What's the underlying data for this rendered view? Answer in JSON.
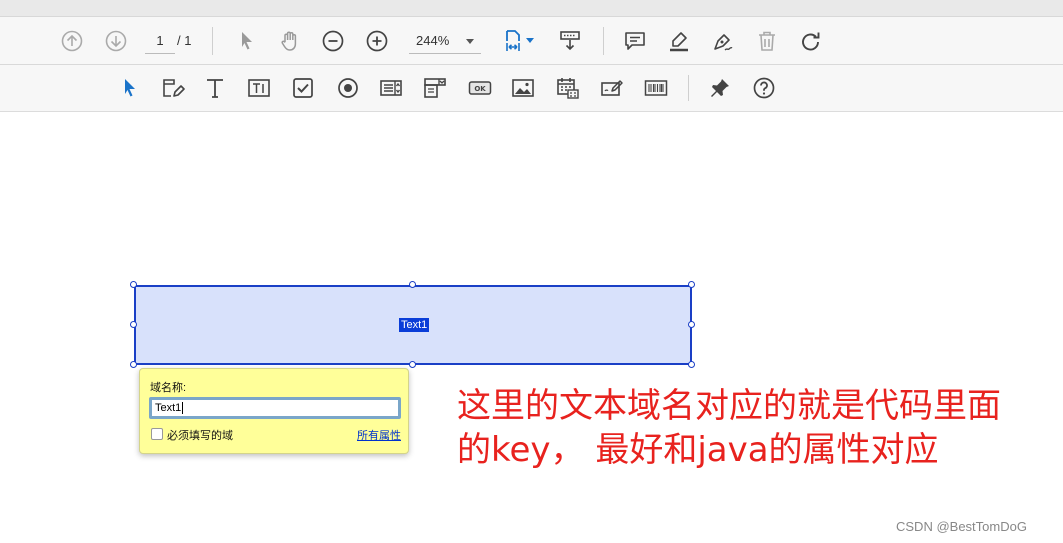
{
  "toolbar1": {
    "page_current": "1",
    "page_total": "/ 1",
    "zoom": "244%"
  },
  "field": {
    "label": "Text1"
  },
  "popup": {
    "title": "域名称:",
    "input_value": "Text1",
    "required_label": "必须填写的域",
    "all_props_link": "所有属性"
  },
  "annotation": {
    "line1": "这里的文本域名对应的就是代码里面",
    "line2": "的key， 最好和java的属性对应"
  },
  "watermark": "CSDN @BestTomDoG",
  "colors": {
    "accent": "#1a73c9",
    "field_border": "#1a3fc6",
    "field_fill": "#d8e1fb",
    "annotation": "#e8221e"
  }
}
